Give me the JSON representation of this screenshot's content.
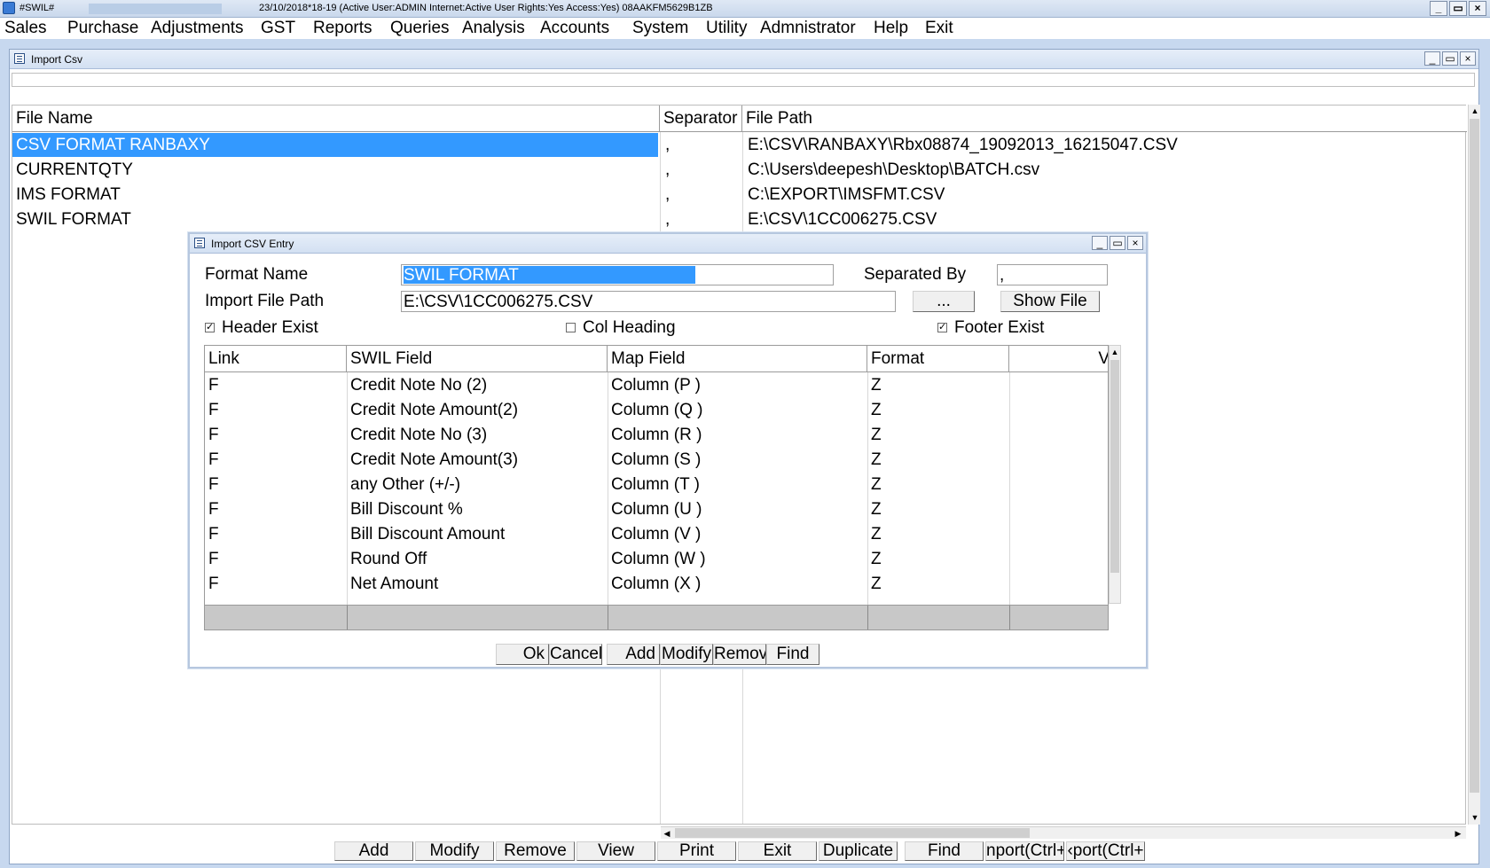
{
  "app": {
    "title": "#SWIL#",
    "status": "23/10/2018*18-19        (Active User:ADMIN Internet:Active  User Rights:Yes Access:Yes) 08AAKFM5629B1ZB",
    "controls": [
      "_",
      "▭",
      "×"
    ]
  },
  "menu": [
    "Sales",
    "Purchase",
    "Adjustments",
    "GST",
    "Reports",
    "Queries",
    "Analysis",
    "Accounts",
    "System",
    "Utility",
    "Admnistrator",
    "Help",
    "Exit"
  ],
  "import_csv": {
    "title": "Import Csv",
    "columns": [
      "File Name",
      "Separator",
      "File Path"
    ],
    "rows": [
      {
        "name": "CSV FORMAT RANBAXY",
        "sep": ",",
        "path": "E:\\CSV\\RANBAXY\\Rbx08874_19092013_16215047.CSV"
      },
      {
        "name": "CURRENTQTY",
        "sep": ",",
        "path": "C:\\Users\\deepesh\\Desktop\\BATCH.csv"
      },
      {
        "name": "IMS FORMAT",
        "sep": ",",
        "path": "C:\\EXPORT\\IMSFMT.CSV"
      },
      {
        "name": "SWIL FORMAT",
        "sep": ",",
        "path": "E:\\CSV\\1CC006275.CSV"
      }
    ],
    "buttons": [
      "Add",
      "Modify",
      "Remove",
      "View",
      "Print",
      "Exit",
      "Duplicate",
      "Find",
      "nport(Ctrl+",
      "‹port(Ctrl+"
    ]
  },
  "entry": {
    "title": "Import CSV Entry",
    "format_name_label": "Format Name",
    "format_name_value": "SWIL FORMAT",
    "separated_by_label": "Separated By",
    "separated_by_value": ",",
    "import_path_label": "Import File Path",
    "import_path_value": "E:\\CSV\\1CC006275.CSV",
    "browse_label": "...",
    "show_file_label": "Show File",
    "header_exist_label": "Header Exist",
    "col_heading_label": "Col Heading",
    "footer_exist_label": "Footer Exist",
    "check_mark": "✓",
    "columns": [
      "Link",
      "SWIL Field",
      "Map Field",
      "Format",
      "V"
    ],
    "rows": [
      {
        "link": "F",
        "field": "Credit Note No (2)",
        "map": "Column (P )",
        "format": "Z"
      },
      {
        "link": "F",
        "field": "Credit Note Amount(2)",
        "map": "Column (Q )",
        "format": "Z"
      },
      {
        "link": "F",
        "field": "Credit Note No (3)",
        "map": "Column (R )",
        "format": "Z"
      },
      {
        "link": "F",
        "field": "Credit Note Amount(3)",
        "map": "Column (S )",
        "format": "Z"
      },
      {
        "link": "F",
        "field": "any Other (+/-)",
        "map": "Column (T )",
        "format": "Z"
      },
      {
        "link": "F",
        "field": "Bill Discount %",
        "map": "Column (U )",
        "format": "Z"
      },
      {
        "link": "F",
        "field": "Bill Discount Amount",
        "map": "Column (V )",
        "format": "Z"
      },
      {
        "link": "F",
        "field": "Round Off",
        "map": "Column (W )",
        "format": "Z"
      },
      {
        "link": "F",
        "field": "Net Amount",
        "map": "Column (X )",
        "format": "Z"
      }
    ],
    "buttons": [
      "Ok",
      "Cancel",
      "Add",
      "Modify",
      "Remove",
      "Find"
    ]
  }
}
